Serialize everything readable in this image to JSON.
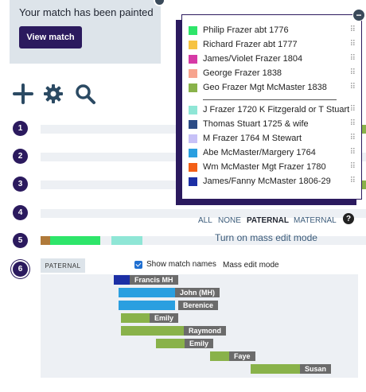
{
  "match_card": {
    "title": "Your match has been painted",
    "view_button": "View match"
  },
  "toolbar": {
    "add_icon": "plus-icon",
    "settings_icon": "gear-icon",
    "search_icon": "search-icon"
  },
  "chromosomes": [
    {
      "label": "1"
    },
    {
      "label": "2"
    },
    {
      "label": "3"
    },
    {
      "label": "4"
    },
    {
      "label": "5"
    },
    {
      "label": "6"
    }
  ],
  "legend": {
    "items": [
      {
        "label": "Philip Frazer abt 1776",
        "color": "#2ee56a"
      },
      {
        "label": "Richard Frazer abt 1777",
        "color": "#f6c342"
      },
      {
        "label": "James/Violet Frazer 1804",
        "color": "#d63aa6"
      },
      {
        "label": "George Frazer 1838",
        "color": "#f7a48f"
      },
      {
        "label": "Geo Frazer Mgt McMaster 1838",
        "color": "#89b24a"
      },
      {
        "label": "J Frazer 1720 K Fitzgerald or T Stuart",
        "color": "#8fe6d6"
      },
      {
        "label": "Thomas Stuart 1725 & wife",
        "color": "#2c4c86"
      },
      {
        "label": "M Frazer 1764 M Stewart",
        "color": "#c7c1f7"
      },
      {
        "label": "Abe McMaster/Margery 1764",
        "color": "#2a9fe0"
      },
      {
        "label": "Wm McMaster Mgt Frazer 1780",
        "color": "#f35f17"
      },
      {
        "label": "James/Fanny McMaster 1806-29",
        "color": "#1c2fa5"
      }
    ]
  },
  "filters": {
    "all": "ALL",
    "none": "NONE",
    "paternal": "PATERNAL",
    "maternal": "MATERNAL"
  },
  "mass_edit_link": "Turn on mass edit mode",
  "detail": {
    "side_tag": "PATERNAL",
    "show_names_label": "Show match names",
    "show_names_checked": true,
    "mass_edit_label": "Mass edit mode",
    "matches": [
      {
        "name": "Francis MH",
        "color": "#1c2fa5"
      },
      {
        "name": "John (MH)",
        "color": "#2a9fe0"
      },
      {
        "name": "Berenice",
        "color": "#2a9fe0"
      },
      {
        "name": "Emily",
        "color": "#89b24a"
      },
      {
        "name": "Raymond",
        "color": "#89b24a"
      },
      {
        "name": "Emily",
        "color": "#89b24a"
      },
      {
        "name": "Faye",
        "color": "#89b24a"
      },
      {
        "name": "Susan",
        "color": "#89b24a"
      }
    ]
  }
}
